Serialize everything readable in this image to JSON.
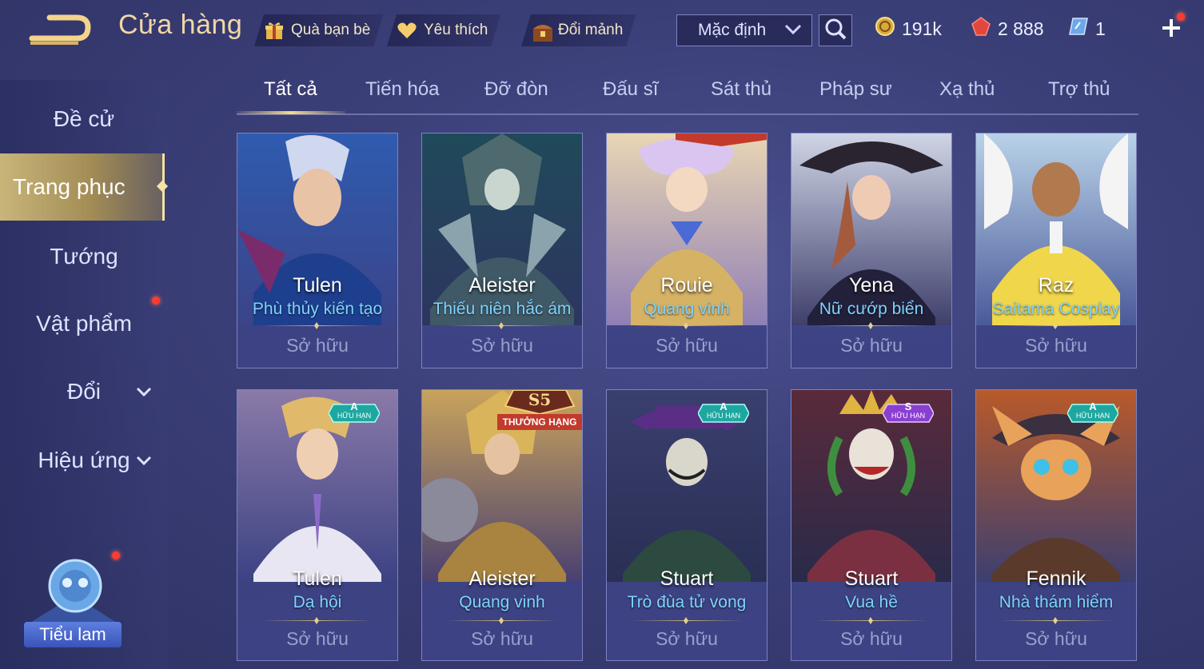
{
  "header": {
    "title": "Cửa hàng",
    "gift_label": "Quà bạn bè",
    "favorite_label": "Yêu thích",
    "exchange_label": "Đổi mảnh",
    "sort_value": "Mặc định"
  },
  "currency": {
    "gold": "191k",
    "gems": "2 888",
    "vouchers": "1"
  },
  "sidebar": {
    "items": [
      {
        "label": "Đề cử"
      },
      {
        "label": "Trang phục"
      },
      {
        "label": "Tướng"
      },
      {
        "label": "Vật phẩm"
      },
      {
        "label": "Đổi"
      },
      {
        "label": "Hiệu ứng"
      }
    ],
    "avatar_label": "Tiểu lam"
  },
  "tabs": [
    "Tất cả",
    "Tiến hóa",
    "Đỡ đòn",
    "Đấu sĩ",
    "Sát thủ",
    "Pháp sư",
    "Xạ thủ",
    "Trợ thủ"
  ],
  "cards": [
    {
      "name": "Tulen",
      "skin": "Phù thủy kiến tạo",
      "status": "Sở hữu"
    },
    {
      "name": "Aleister",
      "skin": "Thiếu niên hắc ám",
      "status": "Sở hữu"
    },
    {
      "name": "Rouie",
      "skin": "Quang vinh",
      "status": "Sở hữu"
    },
    {
      "name": "Yena",
      "skin": "Nữ cướp biển",
      "status": "Sở hữu"
    },
    {
      "name": "Raz",
      "skin": "Saitama Cosplay",
      "status": "Sở hữu"
    },
    {
      "name": "Tulen",
      "skin": "Dạ hội",
      "status": "Sở hữu",
      "badge_grade": "A",
      "badge_text": "HỮU HẠN"
    },
    {
      "name": "Aleister",
      "skin": "Quang vinh",
      "status": "Sở hữu",
      "badge_grade": "S5",
      "badge_text": "THƯỞNG HẠNG"
    },
    {
      "name": "Stuart",
      "skin": "Trò đùa tử vong",
      "status": "Sở hữu",
      "badge_grade": "A",
      "badge_text": "HỮU HẠN"
    },
    {
      "name": "Stuart",
      "skin": "Vua hề",
      "status": "Sở hữu",
      "badge_grade": "S",
      "badge_text": "HỮU HẠN"
    },
    {
      "name": "Fennik",
      "skin": "Nhà thám hiểm",
      "status": "Sở hữu",
      "badge_grade": "A",
      "badge_text": "HỮU HẠN"
    }
  ],
  "colors": {
    "accent_gold": "#f1d7a6",
    "skin_text": "#7fd3ff",
    "background": "#3b3f78",
    "badge_teal": "#1ea7a0",
    "badge_purple": "#8a3fd0",
    "notification": "#ff3b2f"
  },
  "icons": {
    "back": "back-arrow-icon",
    "gift": "gift-icon",
    "favorite": "heart-icon",
    "exchange": "chest-icon",
    "search": "search-icon",
    "gold": "gold-coin-icon",
    "gems": "red-gem-icon",
    "vouchers": "voucher-card-icon",
    "add": "plus-icon"
  }
}
